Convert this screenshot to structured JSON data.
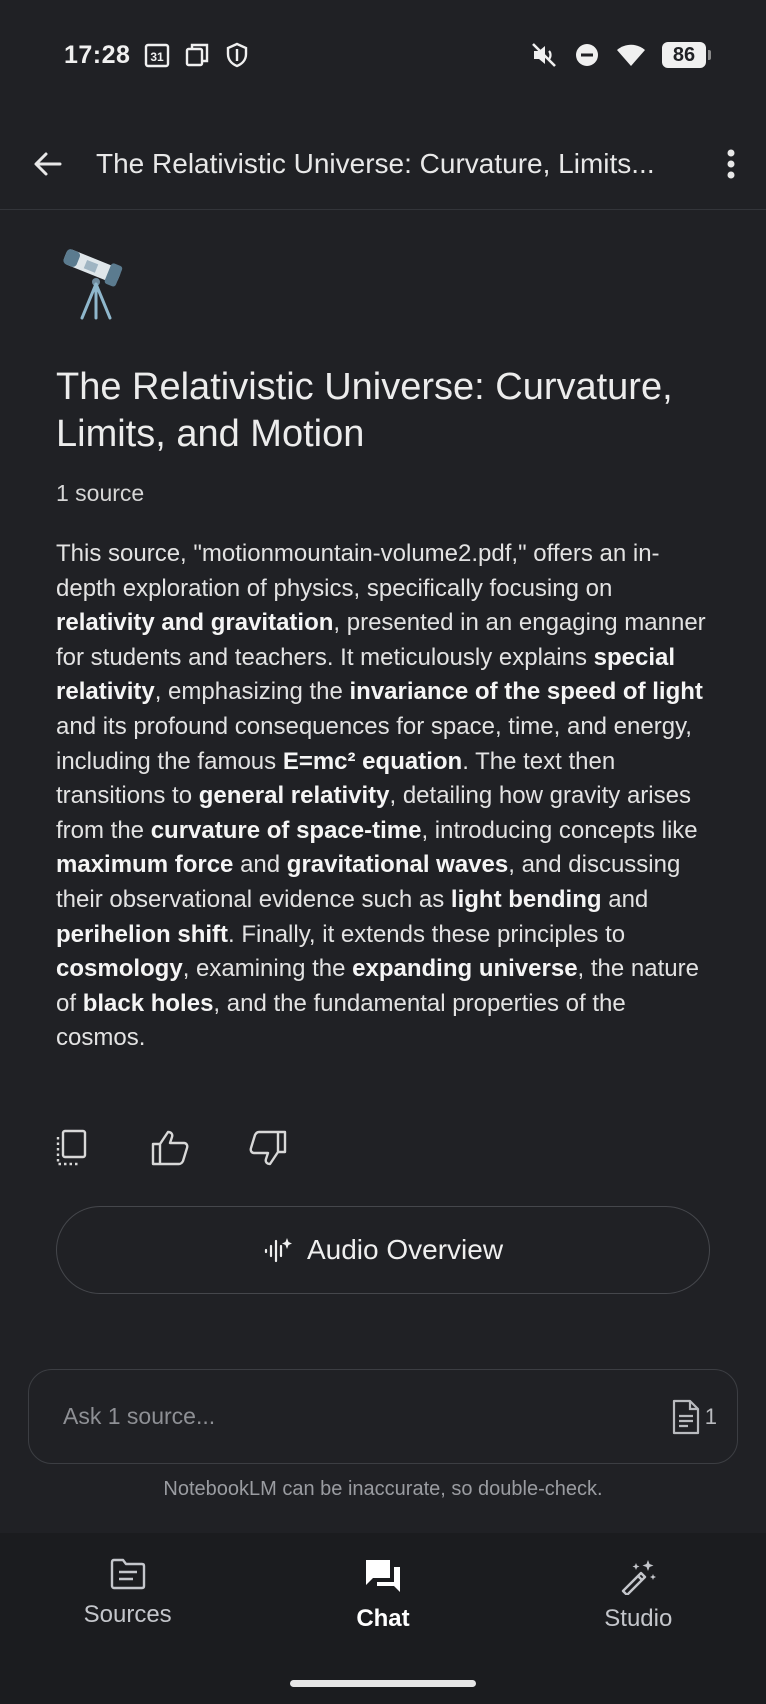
{
  "status_bar": {
    "time": "17:28",
    "calendar_day": "31",
    "battery": "86",
    "left_icons": [
      "calendar-icon",
      "screenshot-icon",
      "shield-icon"
    ],
    "right_icons": [
      "mute-icon",
      "dnd-icon",
      "wifi-icon",
      "battery-icon"
    ]
  },
  "app_bar": {
    "title": "The Relativistic Universe: Curvature, Limits...",
    "back_icon": "arrow-back-icon",
    "menu_icon": "more-vertical-icon"
  },
  "notebook": {
    "emoji": "telescope-icon",
    "title": "The Relativistic Universe: Curvature, Limits, and Motion",
    "source_count": "1 source",
    "summary": [
      {
        "text": "This source, \"motionmountain-volume2.pdf,\" offers an in-depth exploration of physics, specifically focusing on ",
        "bold": false
      },
      {
        "text": "relativity and gravitation",
        "bold": true
      },
      {
        "text": ", presented in an engaging manner for students and teachers. It meticulously explains ",
        "bold": false
      },
      {
        "text": "special relativity",
        "bold": true
      },
      {
        "text": ", emphasizing the ",
        "bold": false
      },
      {
        "text": "invariance of the speed of light",
        "bold": true
      },
      {
        "text": " and its profound consequences for space, time, and energy, including the famous ",
        "bold": false
      },
      {
        "text": "E=mc² equation",
        "bold": true
      },
      {
        "text": ". The text then transitions to ",
        "bold": false
      },
      {
        "text": "general relativity",
        "bold": true
      },
      {
        "text": ", detailing how gravity arises from the ",
        "bold": false
      },
      {
        "text": "curvature of space-time",
        "bold": true
      },
      {
        "text": ", introducing concepts like ",
        "bold": false
      },
      {
        "text": "maximum force",
        "bold": true
      },
      {
        "text": " and ",
        "bold": false
      },
      {
        "text": "gravitational waves",
        "bold": true
      },
      {
        "text": ", and discussing their observational evidence such as ",
        "bold": false
      },
      {
        "text": "light bending",
        "bold": true
      },
      {
        "text": " and ",
        "bold": false
      },
      {
        "text": "perihelion shift",
        "bold": true
      },
      {
        "text": ". Finally, it extends these principles to ",
        "bold": false
      },
      {
        "text": "cosmology",
        "bold": true
      },
      {
        "text": ", examining the ",
        "bold": false
      },
      {
        "text": "expanding universe",
        "bold": true
      },
      {
        "text": ", the nature of ",
        "bold": false
      },
      {
        "text": "black holes",
        "bold": true
      },
      {
        "text": ", and the fundamental properties of the cosmos.",
        "bold": false
      }
    ]
  },
  "actions": {
    "icons": [
      "copy-icon",
      "thumbs-up-icon",
      "thumbs-down-icon"
    ]
  },
  "audio_overview": {
    "label": "Audio Overview",
    "icon": "audio-waveform-sparkle-icon"
  },
  "chat_input": {
    "placeholder": "Ask 1 source...",
    "source_count": "1",
    "source_icon": "document-icon"
  },
  "disclaimer": "NotebookLM can be inaccurate, so double-check.",
  "bottom_nav": {
    "items": [
      {
        "label": "Sources",
        "icon": "folder-icon",
        "active": false
      },
      {
        "label": "Chat",
        "icon": "chat-bubbles-icon",
        "active": true
      },
      {
        "label": "Studio",
        "icon": "magic-wand-icon",
        "active": false
      }
    ]
  },
  "colors": {
    "background": "#202125",
    "nav_background": "#1b1c1f",
    "text_primary": "#e3e3e3",
    "text_muted": "#9a9ca1",
    "border": "#45474c"
  }
}
